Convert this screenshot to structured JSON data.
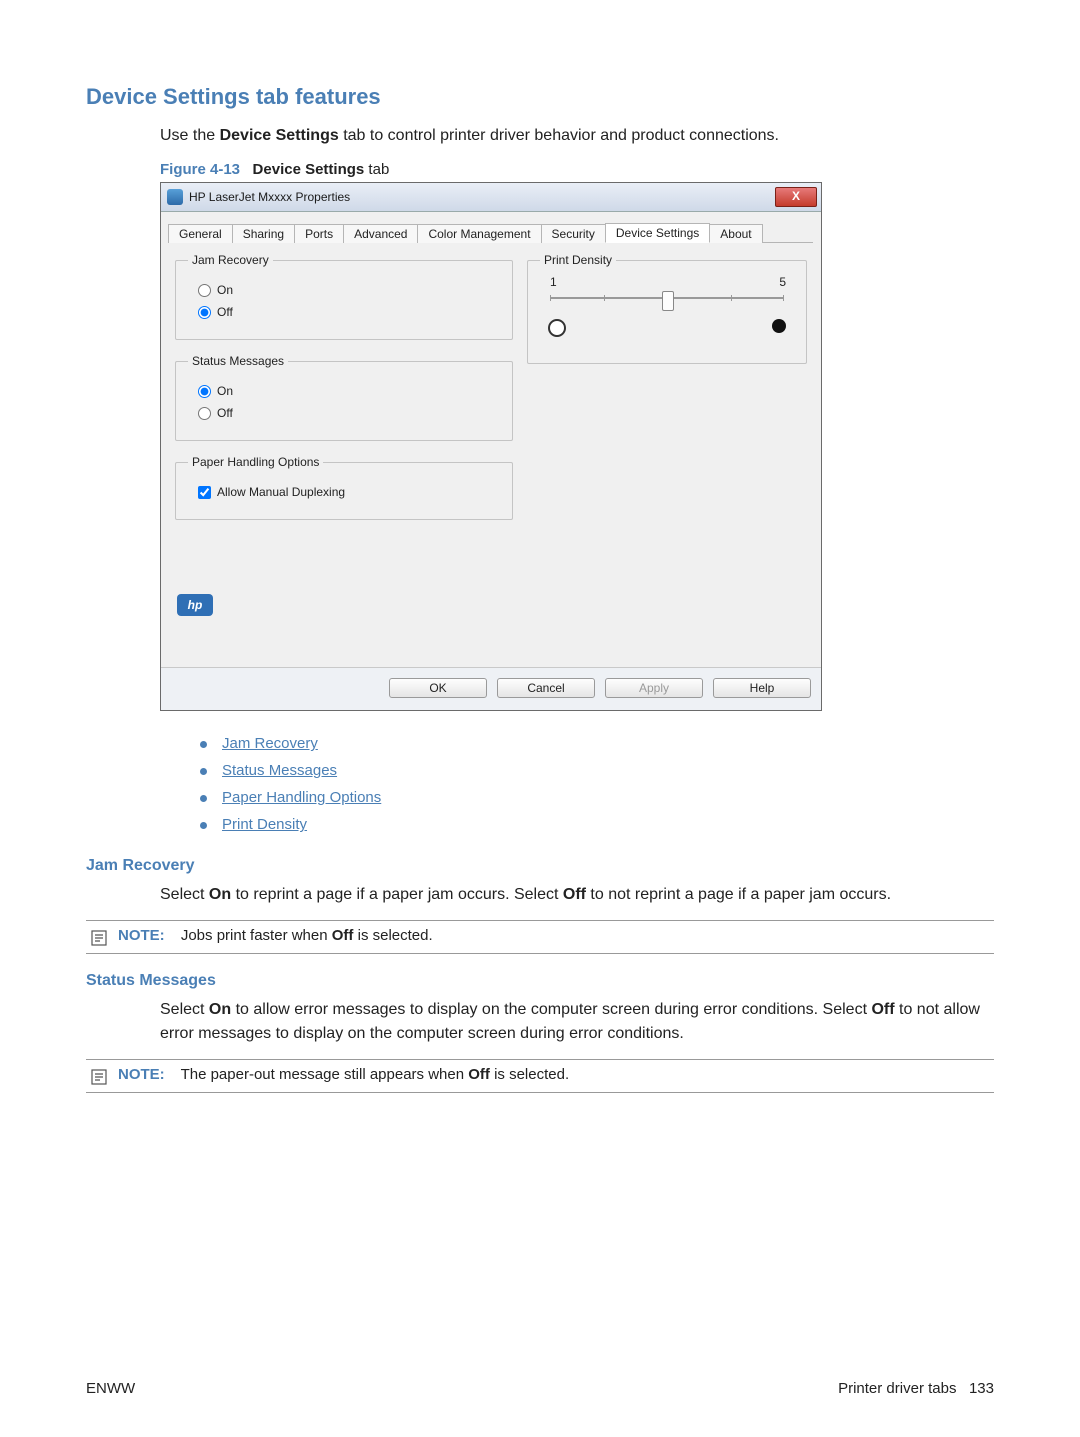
{
  "heading_main": "Device Settings tab features",
  "intro": {
    "prefix": "Use the ",
    "bold1": "Device Settings",
    "suffix": " tab to control printer driver behavior and product connections."
  },
  "figure_caption": {
    "label": "Figure 4-13",
    "text_bold": "Device Settings",
    "text_rest": " tab"
  },
  "window": {
    "title": "HP LaserJet Mxxxx Properties",
    "close": "X",
    "tabs": [
      "General",
      "Sharing",
      "Ports",
      "Advanced",
      "Color Management",
      "Security",
      "Device Settings",
      "About"
    ],
    "active_tab_index": 6,
    "groups": {
      "jam_recovery": {
        "legend": "Jam Recovery",
        "on": "On",
        "off": "Off",
        "selected": "off"
      },
      "status_messages": {
        "legend": "Status Messages",
        "on": "On",
        "off": "Off",
        "selected": "on"
      },
      "paper_handling": {
        "legend": "Paper Handling Options",
        "checkbox_label": "Allow Manual Duplexing",
        "checked": true
      },
      "print_density": {
        "legend": "Print Density",
        "min": "1",
        "max": "5",
        "value": 3
      }
    },
    "hp_badge": "hp",
    "buttons": {
      "ok": "OK",
      "cancel": "Cancel",
      "apply": "Apply",
      "help": "Help"
    }
  },
  "links": [
    "Jam Recovery",
    "Status Messages",
    "Paper Handling Options",
    "Print Density"
  ],
  "sections": {
    "jam_recovery": {
      "heading": "Jam Recovery",
      "para": {
        "p1": "Select ",
        "b1": "On",
        "p2": " to reprint a page if a paper jam occurs. Select ",
        "b2": "Off",
        "p3": " to not reprint a page if a paper jam occurs."
      },
      "note": {
        "label": "NOTE:",
        "p1": "Jobs print faster when ",
        "b1": "Off",
        "p2": " is selected."
      }
    },
    "status_messages": {
      "heading": "Status Messages",
      "para": {
        "p1": "Select ",
        "b1": "On",
        "p2": " to allow error messages to display on the computer screen during error conditions. Select ",
        "b2": "Off",
        "p3": " to not allow error messages to display on the computer screen during error conditions."
      },
      "note": {
        "label": "NOTE:",
        "p1": "The paper-out message still appears when ",
        "b1": "Off",
        "p2": " is selected."
      }
    }
  },
  "footer": {
    "left": "ENWW",
    "right_text": "Printer driver tabs",
    "page": "133"
  }
}
